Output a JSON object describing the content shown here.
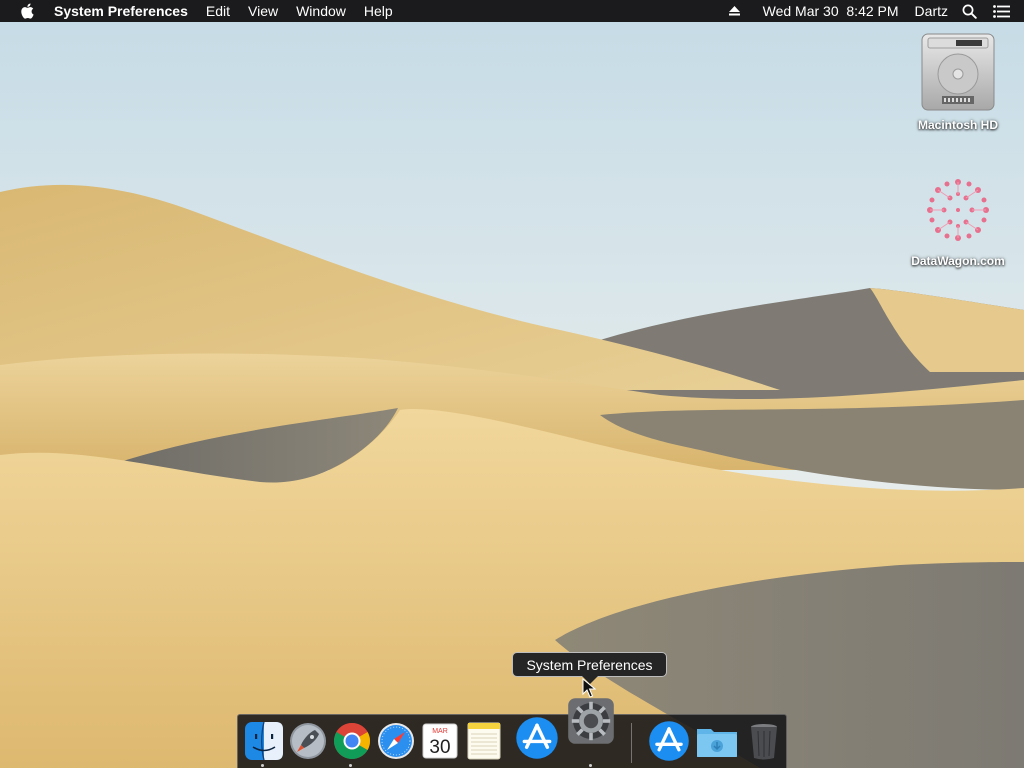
{
  "menubar": {
    "apple_icon": "apple-icon",
    "app_name": "System Preferences",
    "menus": [
      "Edit",
      "View",
      "Window",
      "Help"
    ],
    "eject_icon": "eject-icon",
    "datetime": "Wed Mar 30  8:42 PM",
    "user": "Dartz",
    "search_icon": "spotlight-search-icon",
    "list_icon": "notification-center-icon"
  },
  "desktop": {
    "icons": [
      {
        "label": "Macintosh HD",
        "icon": "hard-drive-icon"
      },
      {
        "label": "DataWagon.com",
        "icon": "datawagon-logo-icon"
      }
    ]
  },
  "tooltip": {
    "text": "System Preferences"
  },
  "dock": {
    "items": [
      {
        "name": "Finder",
        "icon": "finder-icon",
        "running": true
      },
      {
        "name": "Launchpad",
        "icon": "launchpad-icon",
        "running": false
      },
      {
        "name": "Google Chrome",
        "icon": "chrome-icon",
        "running": true
      },
      {
        "name": "Safari",
        "icon": "safari-icon",
        "running": false
      },
      {
        "name": "Calendar",
        "icon": "calendar-icon",
        "running": false,
        "month": "MAR",
        "day": "30"
      },
      {
        "name": "Notes",
        "icon": "notes-icon",
        "running": false
      },
      {
        "name": "App Store",
        "icon": "app-store-icon",
        "running": false
      },
      {
        "name": "System Preferences",
        "icon": "system-preferences-icon",
        "running": true
      },
      {
        "name": "Applications",
        "icon": "applications-stack-icon",
        "running": false
      },
      {
        "name": "Downloads",
        "icon": "downloads-folder-icon",
        "running": false
      },
      {
        "name": "Trash",
        "icon": "trash-icon",
        "running": false
      }
    ]
  },
  "colors": {
    "menubar_bg": "#1b1b1d",
    "sky_top": "#c9dde8",
    "sand": "#e4c27f",
    "shadow_dune": "#7e7a72"
  }
}
